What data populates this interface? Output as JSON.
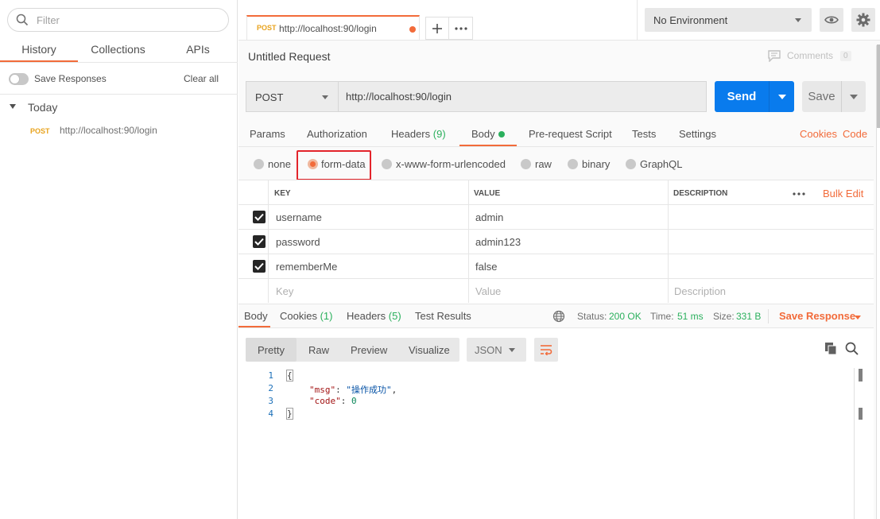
{
  "sidebar": {
    "filter_placeholder": "Filter",
    "tabs": [
      "History",
      "Collections",
      "APIs"
    ],
    "save_responses_label": "Save Responses",
    "clear_all_label": "Clear all",
    "group_label": "Today",
    "history": [
      {
        "method": "POST",
        "url": "http://localhost:90/login"
      }
    ]
  },
  "tabbar": {
    "active_tab": {
      "method": "POST",
      "url": "http://localhost:90/login"
    },
    "environment": "No Environment"
  },
  "request": {
    "title": "Untitled Request",
    "comments_label": "Comments",
    "comments_count": "0",
    "method": "POST",
    "url": "http://localhost:90/login",
    "send_label": "Send",
    "save_label": "Save",
    "tabs": {
      "params": "Params",
      "authorization": "Authorization",
      "headers": "Headers",
      "headers_count": "(9)",
      "body": "Body",
      "prerequest": "Pre-request Script",
      "tests": "Tests",
      "settings": "Settings"
    },
    "cookies_link": "Cookies",
    "code_link": "Code",
    "body_types": [
      "none",
      "form-data",
      "x-www-form-urlencoded",
      "raw",
      "binary",
      "GraphQL"
    ],
    "selected_body_type": "form-data",
    "table": {
      "headers": {
        "key": "KEY",
        "value": "VALUE",
        "description": "DESCRIPTION"
      },
      "bulk_edit": "Bulk Edit",
      "rows": [
        {
          "key": "username",
          "value": "admin",
          "checked": true
        },
        {
          "key": "password",
          "value": "admin123",
          "checked": true
        },
        {
          "key": "rememberMe",
          "value": "false",
          "checked": true
        }
      ],
      "placeholders": {
        "key": "Key",
        "value": "Value",
        "description": "Description"
      }
    }
  },
  "response": {
    "tabs": {
      "body": "Body",
      "cookies": "Cookies",
      "cookies_count": "(1)",
      "headers": "Headers",
      "headers_count": "(5)",
      "test_results": "Test Results"
    },
    "status_label": "Status:",
    "status_value": "200 OK",
    "time_label": "Time:",
    "time_value": "51 ms",
    "size_label": "Size:",
    "size_value": "331 B",
    "save_response": "Save Response",
    "views": [
      "Pretty",
      "Raw",
      "Preview",
      "Visualize"
    ],
    "language": "JSON",
    "code_lines": {
      "l1": "1",
      "l2": "2",
      "l3": "3",
      "l4": "4",
      "open": "{",
      "k1": "\"msg\"",
      "v1": "\"操作成功\"",
      "k2": "\"code\"",
      "v2": "0",
      "close": "}"
    }
  },
  "colors": {
    "accent": "#f26b3a",
    "send_blue": "#097bed",
    "success_green": "#2bb05d",
    "post_method": "#e8a31d",
    "highlight_red": "#e3242b"
  }
}
